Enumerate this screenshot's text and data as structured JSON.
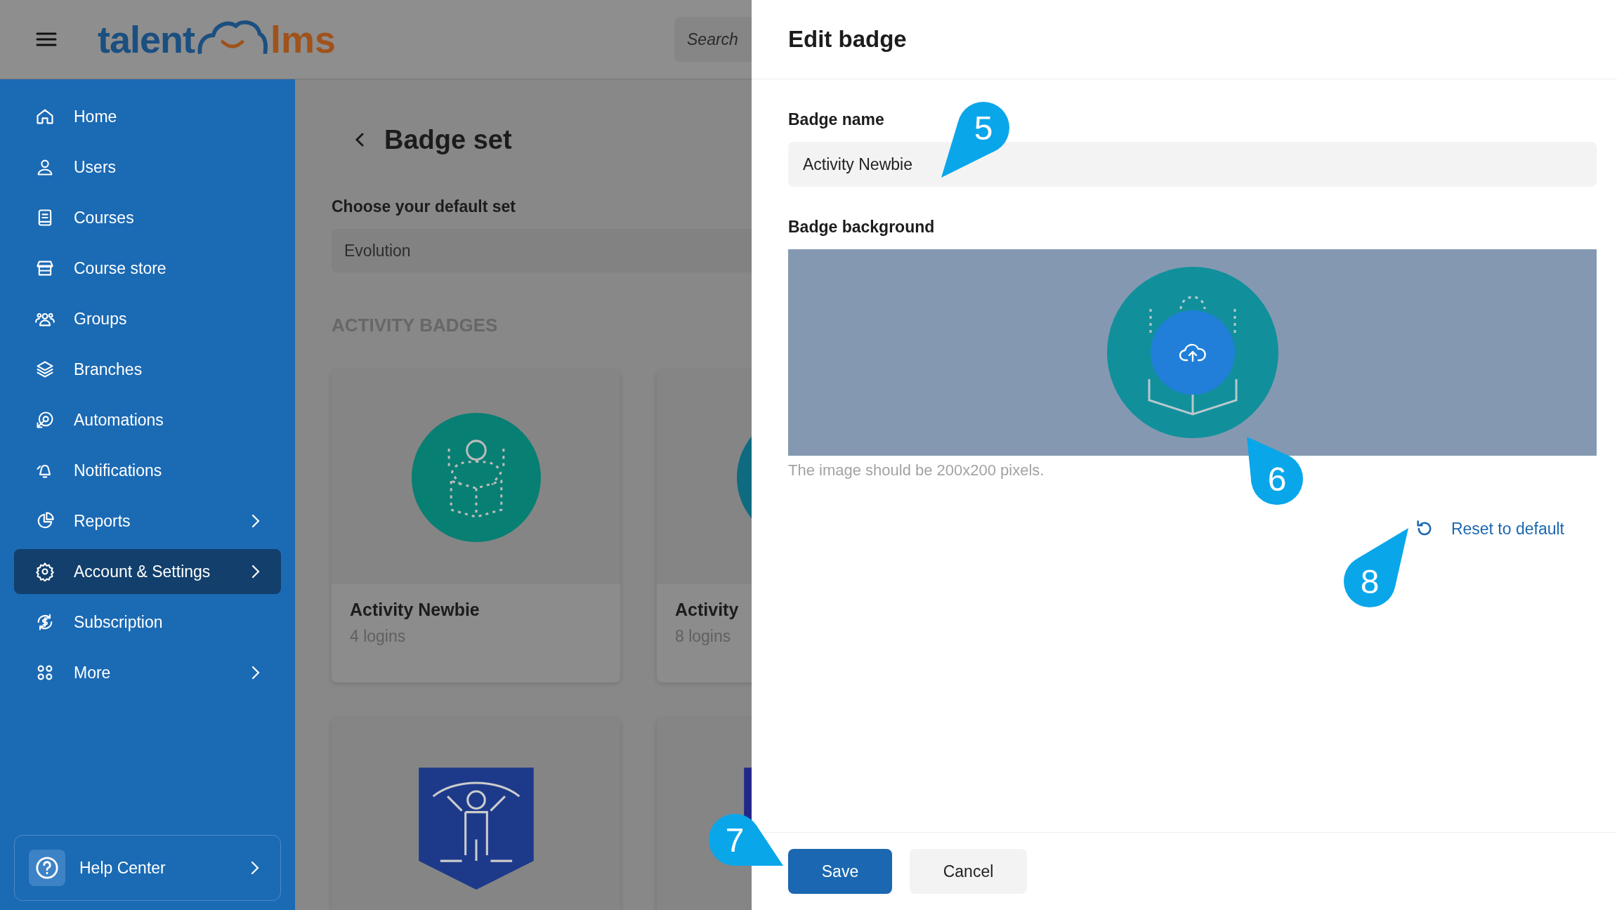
{
  "header": {
    "logo": {
      "left": "talent",
      "right": "lms"
    },
    "search": {
      "placeholder": "Search"
    }
  },
  "sidebar": {
    "items": [
      {
        "label": "Home",
        "has_submenu": false,
        "selected": false
      },
      {
        "label": "Users",
        "has_submenu": false,
        "selected": false
      },
      {
        "label": "Courses",
        "has_submenu": false,
        "selected": false
      },
      {
        "label": "Course store",
        "has_submenu": false,
        "selected": false
      },
      {
        "label": "Groups",
        "has_submenu": false,
        "selected": false
      },
      {
        "label": "Branches",
        "has_submenu": false,
        "selected": false
      },
      {
        "label": "Automations",
        "has_submenu": false,
        "selected": false
      },
      {
        "label": "Notifications",
        "has_submenu": false,
        "selected": false
      },
      {
        "label": "Reports",
        "has_submenu": true,
        "selected": false
      },
      {
        "label": "Account & Settings",
        "has_submenu": true,
        "selected": true
      },
      {
        "label": "Subscription",
        "has_submenu": false,
        "selected": false
      },
      {
        "label": "More",
        "has_submenu": true,
        "selected": false
      }
    ],
    "help": {
      "label": "Help Center"
    }
  },
  "page": {
    "title": "Badge set",
    "default_set_label": "Choose your default set",
    "default_set_value": "Evolution",
    "section": "ACTIVITY BADGES",
    "badges": [
      {
        "kind": "circle",
        "color": "#087f73",
        "name": "Activity Newbie",
        "requirement": "4 logins"
      },
      {
        "kind": "circle",
        "color": "#0e6b80",
        "name": "Activity",
        "requirement": "8 logins"
      },
      {
        "kind": "shield",
        "color": "#1d3a8a"
      },
      {
        "kind": "shield",
        "color": "#22288a"
      }
    ]
  },
  "drawer": {
    "title": "Edit badge",
    "name_label": "Badge name",
    "name_value": "Activity Newbie",
    "background_label": "Badge background",
    "hint": "The image should be 200x200 pixels.",
    "reset": "Reset to default",
    "buttons": [
      {
        "label": "Save",
        "kind": "primary"
      },
      {
        "label": "Cancel",
        "kind": "secondary"
      }
    ]
  },
  "callouts": [
    {
      "label": "5"
    },
    {
      "label": "6"
    },
    {
      "label": "7"
    },
    {
      "label": "8"
    }
  ]
}
